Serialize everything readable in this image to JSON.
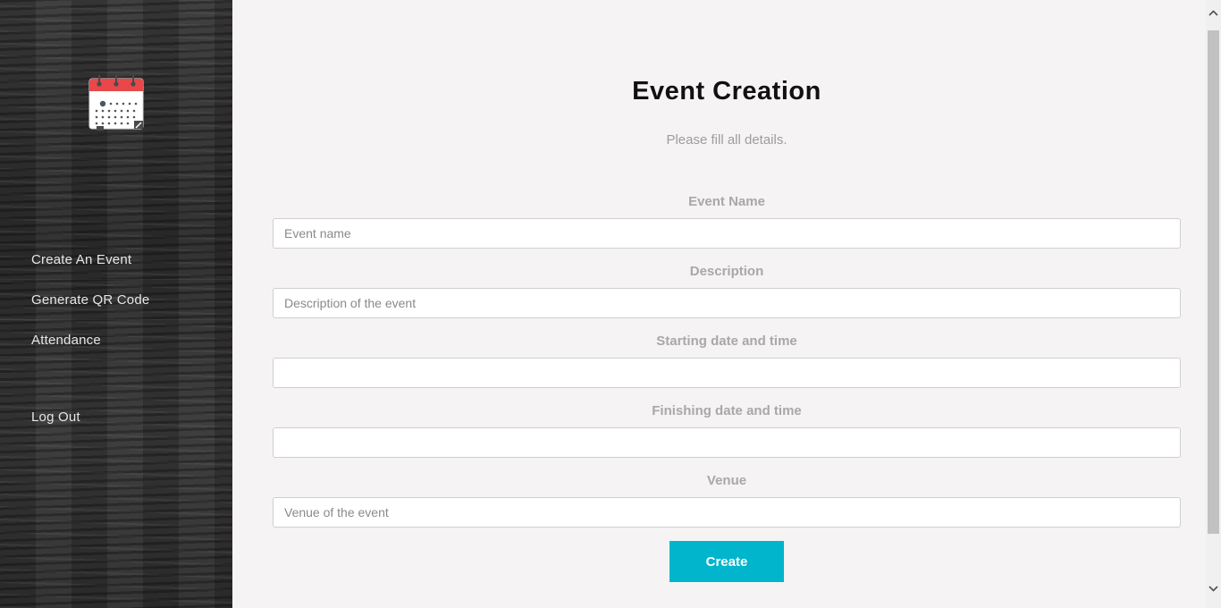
{
  "sidebar": {
    "logo_icon": "calendar-icon",
    "items": [
      {
        "label": "Create An Event"
      },
      {
        "label": "Generate QR Code"
      },
      {
        "label": "Attendance"
      }
    ],
    "logout_label": "Log Out"
  },
  "form": {
    "title": "Event Creation",
    "subtitle": "Please fill all details.",
    "fields": {
      "event_name": {
        "label": "Event Name",
        "placeholder": "Event name",
        "value": ""
      },
      "description": {
        "label": "Description",
        "placeholder": "Description of the event",
        "value": ""
      },
      "start": {
        "label": "Starting date and time",
        "placeholder": "",
        "value": ""
      },
      "finish": {
        "label": "Finishing date and time",
        "placeholder": "",
        "value": ""
      },
      "venue": {
        "label": "Venue",
        "placeholder": "Venue of the event",
        "value": ""
      }
    },
    "submit_label": "Create"
  },
  "colors": {
    "accent": "#00b5cc",
    "sidebar_bg": "#333333",
    "main_bg": "#f5f3f3",
    "calendar_red": "#e8484a"
  }
}
